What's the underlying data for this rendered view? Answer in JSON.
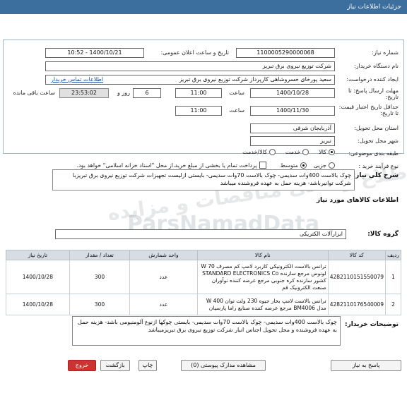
{
  "header": {
    "title": "جزئیات اطلاعات نیاز"
  },
  "need_number": {
    "label": "شماره نیاز:",
    "value": "1100005290000068"
  },
  "announce": {
    "label": "تاریخ و ساعت اعلان عمومی:",
    "value": "1400/10/21 - 10:52"
  },
  "buyer": {
    "label": "نام دستگاه خریدار:",
    "value": "شرکت توزیع نیروی برق تبریز"
  },
  "creator": {
    "label": "ایجاد کننده درخواست:",
    "value": "سعید پورخای خسروشاهی کارپرداز شرکت توزیع نیروی برق تبریز",
    "contact_link": "اطلاعات تماس خریدار"
  },
  "deadline_send": {
    "label": "مهلت ارسال پاسخ: تا تاریخ:",
    "date": "1400/10/28",
    "time_label": "ساعت",
    "time": "11:00",
    "days": "6",
    "days_label": "روز و",
    "remaining": "23:53:02",
    "remaining_label": "ساعت باقی مانده"
  },
  "validity": {
    "label": "حداقل تاریخ اعتبار قیمت: تا تاریخ:",
    "date": "1400/11/30",
    "time_label": "ساعت",
    "time": "11:00"
  },
  "province": {
    "label": "استان محل تحویل:",
    "value": "آذربایجان شرقی"
  },
  "city": {
    "label": "شهر محل تحویل:",
    "value": "تبریز"
  },
  "category": {
    "label": "طبقه بندی موضوعی:",
    "options": [
      "کالا",
      "خدمت",
      "کالا/خدمت"
    ],
    "selected": 0
  },
  "process": {
    "label": "نوع فرآیند خرید :",
    "options": [
      "جزیی",
      "متوسط"
    ],
    "selected": 1,
    "payment_note": "پرداخت تمام یا بخشی از مبلغ خرید،از محل \"اسناد خزانه اسلامی\" خواهد بود."
  },
  "general_desc": {
    "label": "شرح کلی نیاز:",
    "value": "چوک بالاست 400وات سدیمی- چوک بالاست 70وات سدیمی- بایستی ازلیست تجهیزات شرکت توزیع نیروی برق تبریزبا شرکت توانیرباشد- هزینه حمل به عهده فروشنده میباشد"
  },
  "goods_info": {
    "title": "اطلاعات کالاهای مورد نیاز"
  },
  "goods_group": {
    "label": "گروه کالا:",
    "value": "ابزارآلات الکتریکی"
  },
  "table": {
    "headers": [
      "ردیف",
      "کد کالا",
      "نام کالا",
      "واحد شمارش",
      "تعداد / مقدار",
      "تاریخ نیاز"
    ],
    "rows": [
      {
        "row": "1",
        "code": "4282110151550079",
        "name": "ترانس بالاست الکترونیکی کاربرد لامپ کم مصرف 70 W لونوس مرجع سازنده STANDARD ELECTRONICS Co کشور سازنده کره جنوبی مرجع عرضه کننده نوآوران صنعت الکترونیک قم",
        "unit": "عدد",
        "qty": "300",
        "date": "1400/10/28"
      },
      {
        "row": "2",
        "code": "4282110176540009",
        "name": "ترانس بالاست لامپ بخار جیوه 230 ولت توان 400 W مدل BM4006 مرجع عرضه کننده صنایع راما پارسیان",
        "unit": "عدد",
        "qty": "300",
        "date": "1400/10/28"
      }
    ]
  },
  "buyer_desc": {
    "label": "توضیحات خریدار:",
    "value": "چوک بالاست 400وات سدیمی- چوک بالاست 70وات سدیمی- بایستی چوکها ازنوع آلومنیومی باشد- هزینه حمل به عهده فروشنده و محل تحویل  اجناس انبار شرکت توزیع نیروی برق تبریزمیباشد"
  },
  "buttons": {
    "reply": "پاسخ به نیاز",
    "attachments": "مشاهده مدارک پیوستی (0)",
    "print": "چاپ",
    "back": "بازگشت",
    "exit": "خروج"
  },
  "watermark": {
    "brand": "ParsNamadData",
    "text": "پایگاه اطلاع رسانی مناقصات و مزایده"
  },
  "colors": {
    "header": "#3d6f9e",
    "exit_button": "#cc3333"
  }
}
